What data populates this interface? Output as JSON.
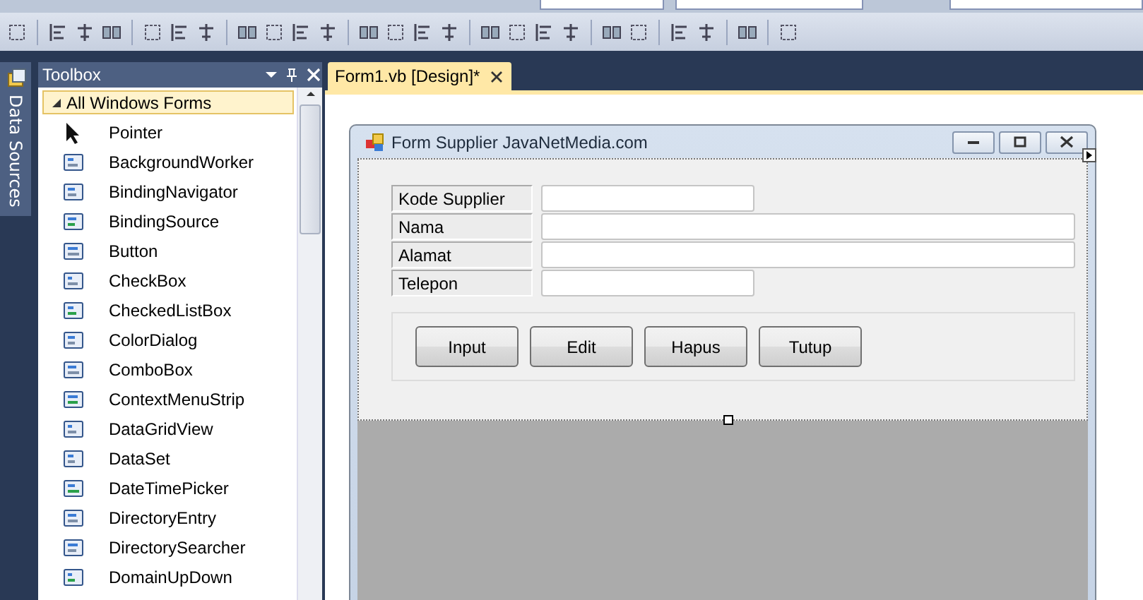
{
  "side_tab": {
    "label": "Data Sources"
  },
  "toolbox": {
    "title": "Toolbox",
    "group": {
      "label": "All Windows Forms",
      "expanded": true
    },
    "items": [
      {
        "label": "Pointer"
      },
      {
        "label": "BackgroundWorker"
      },
      {
        "label": "BindingNavigator"
      },
      {
        "label": "BindingSource"
      },
      {
        "label": "Button"
      },
      {
        "label": "CheckBox"
      },
      {
        "label": "CheckedListBox"
      },
      {
        "label": "ColorDialog"
      },
      {
        "label": "ComboBox"
      },
      {
        "label": "ContextMenuStrip"
      },
      {
        "label": "DataGridView"
      },
      {
        "label": "DataSet"
      },
      {
        "label": "DateTimePicker"
      },
      {
        "label": "DirectoryEntry"
      },
      {
        "label": "DirectorySearcher"
      },
      {
        "label": "DomainUpDown"
      }
    ]
  },
  "document_tab": {
    "label": "Form1.vb [Design]*",
    "selected": true
  },
  "form": {
    "title": "Form Supplier JavaNetMedia.com",
    "fields": [
      {
        "label": "Kode Supplier",
        "kind": "short"
      },
      {
        "label": "Nama",
        "kind": "long"
      },
      {
        "label": "Alamat",
        "kind": "long"
      },
      {
        "label": "Telepon",
        "kind": "short"
      }
    ],
    "buttons": [
      "Input",
      "Edit",
      "Hapus",
      "Tutup"
    ]
  }
}
